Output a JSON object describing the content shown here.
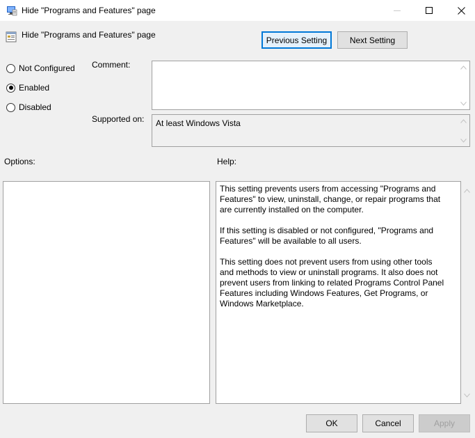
{
  "window": {
    "title": "Hide \"Programs and Features\" page"
  },
  "policy": {
    "title": "Hide \"Programs and Features\" page"
  },
  "nav": {
    "previous_label": "Previous Setting",
    "next_label": "Next Setting"
  },
  "state": {
    "options": [
      {
        "label": "Not Configured",
        "checked": false
      },
      {
        "label": "Enabled",
        "checked": true
      },
      {
        "label": "Disabled",
        "checked": false
      }
    ]
  },
  "comment": {
    "label": "Comment:",
    "value": ""
  },
  "supported": {
    "label": "Supported on:",
    "value": "At least Windows Vista"
  },
  "options_panel": {
    "label": "Options:"
  },
  "help": {
    "label": "Help:",
    "paragraphs": [
      "This setting prevents users from accessing \"Programs and Features\" to view, uninstall, change, or repair programs that are currently installed on the computer.",
      "If this setting is disabled or not configured, \"Programs and Features\" will be available to all users.",
      "This setting does not prevent users from using other tools and methods to view or uninstall programs.  It also does not prevent users from linking to related Programs Control Panel Features including Windows Features, Get Programs, or Windows Marketplace."
    ]
  },
  "footer": {
    "ok_label": "OK",
    "cancel_label": "Cancel",
    "apply_label": "Apply"
  }
}
